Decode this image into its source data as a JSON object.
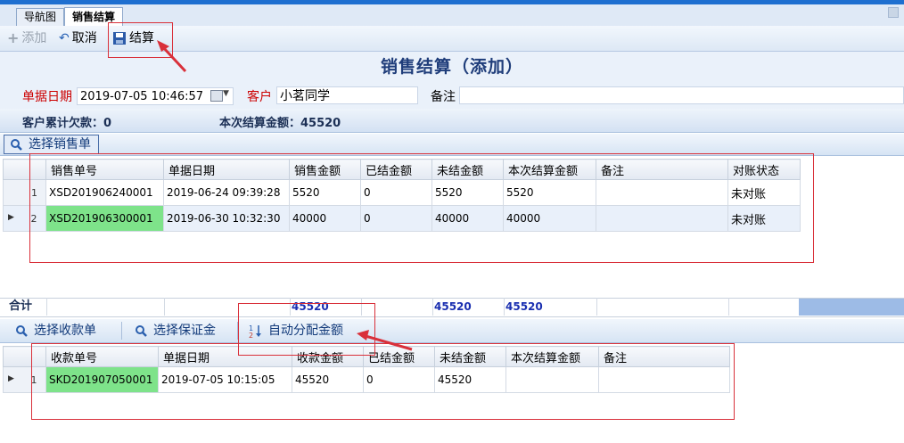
{
  "tabs": [
    {
      "label": "导航图",
      "active": false
    },
    {
      "label": "销售结算",
      "active": true
    }
  ],
  "toolbar": {
    "add_label": "添加",
    "cancel_label": "取消",
    "settle_label": "结算"
  },
  "page_title": "销售结算（添加）",
  "form": {
    "date_label": "单据日期",
    "date_value": "2019-07-05 10:46:57",
    "customer_label": "客户",
    "customer_value": "小茗同学",
    "remark_label": "备注",
    "remark_value": ""
  },
  "summary": {
    "debt_text": "客户累计欠款：0",
    "settle_text": "本次结算金额：45520"
  },
  "sales_section": {
    "button_label": "选择销售单",
    "columns": [
      "销售单号",
      "单据日期",
      "销售金额",
      "已结金额",
      "未结金额",
      "本次结算金额",
      "备注",
      "对账状态"
    ],
    "rows": [
      {
        "index": "1",
        "order_no": "XSD201906240001",
        "date": "2019-06-24 09:39:28",
        "amount": "5520",
        "settled": "0",
        "unsettled": "5520",
        "this_settle": "5520",
        "remark": "",
        "status": "未对账"
      },
      {
        "index": "2",
        "order_no": "XSD201906300001",
        "date": "2019-06-30 10:32:30",
        "amount": "40000",
        "settled": "0",
        "unsettled": "40000",
        "this_settle": "40000",
        "remark": "",
        "status": "未对账"
      }
    ],
    "total_label": "合计",
    "total_amount": "45520",
    "total_unsettled": "45520",
    "total_this_settle": "45520"
  },
  "receipt_section": {
    "btn_receipt": "选择收款单",
    "btn_deposit": "选择保证金",
    "btn_auto": "自动分配金额",
    "columns": [
      "收款单号",
      "单据日期",
      "收款金额",
      "已结金额",
      "未结金额",
      "本次结算金额",
      "备注"
    ],
    "rows": [
      {
        "index": "1",
        "receipt_no": "SKD201907050001",
        "date": "2019-07-05 10:15:05",
        "amount": "45520",
        "settled": "0",
        "unsettled": "45520",
        "this_settle": "",
        "remark": ""
      }
    ]
  },
  "colors": {
    "accent": "#1f3d7a",
    "highlight_green": "#7ee38a",
    "annotation_red": "#d9303a"
  }
}
